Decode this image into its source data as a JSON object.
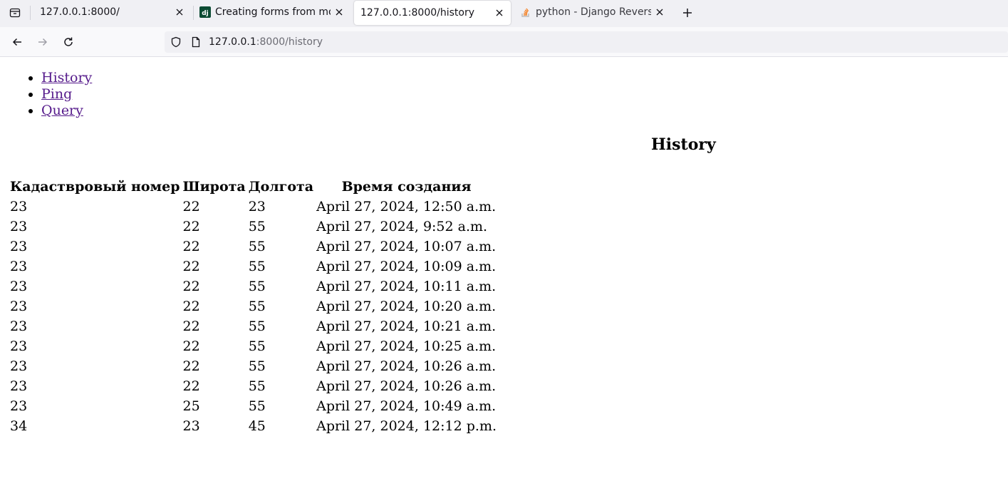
{
  "browser": {
    "tabs": [
      {
        "title": "127.0.0.1:8000/",
        "favicon": "none",
        "active": false
      },
      {
        "title": "Creating forms from mod",
        "favicon": "django-icon",
        "favicon_text": "dj",
        "active": false
      },
      {
        "title": "127.0.0.1:8000/history",
        "favicon": "none",
        "active": true
      },
      {
        "title": "python - Django Reverse",
        "favicon": "stackoverflow-icon",
        "active": false
      }
    ],
    "url_host": "127.0.0.1",
    "url_rest": ":8000/history"
  },
  "nav": {
    "links": [
      "History",
      "Ping",
      "Query"
    ]
  },
  "page": {
    "heading": "History"
  },
  "table": {
    "headers": [
      "Кадаствровый номер",
      "Широта",
      "Долгота",
      "Время создания"
    ],
    "rows": [
      [
        "23",
        "22",
        "23",
        "April 27, 2024, 12:50 a.m."
      ],
      [
        "23",
        "22",
        "55",
        "April 27, 2024, 9:52 a.m."
      ],
      [
        "23",
        "22",
        "55",
        "April 27, 2024, 10:07 a.m."
      ],
      [
        "23",
        "22",
        "55",
        "April 27, 2024, 10:09 a.m."
      ],
      [
        "23",
        "22",
        "55",
        "April 27, 2024, 10:11 a.m."
      ],
      [
        "23",
        "22",
        "55",
        "April 27, 2024, 10:20 a.m."
      ],
      [
        "23",
        "22",
        "55",
        "April 27, 2024, 10:21 a.m."
      ],
      [
        "23",
        "22",
        "55",
        "April 27, 2024, 10:25 a.m."
      ],
      [
        "23",
        "22",
        "55",
        "April 27, 2024, 10:26 a.m."
      ],
      [
        "23",
        "22",
        "55",
        "April 27, 2024, 10:26 a.m."
      ],
      [
        "23",
        "25",
        "55",
        "April 27, 2024, 10:49 a.m."
      ],
      [
        "34",
        "23",
        "45",
        "April 27, 2024, 12:12 p.m."
      ]
    ]
  },
  "colors": {
    "link_visited": "#551a8b",
    "tabbar_bg": "#f0f0f4",
    "stackoverflow_orange": "#f48024",
    "django_green": "#0c4b33"
  }
}
